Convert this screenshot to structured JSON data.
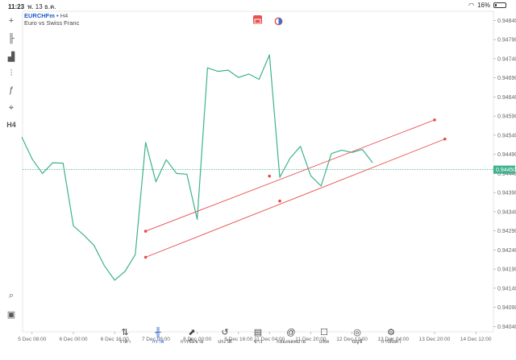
{
  "status_bar": {
    "time": "11:23",
    "date": "พ. 13 ธ.ค.",
    "battery": "16%",
    "battery_level": 0.16
  },
  "symbol": {
    "name": "EURCHFm",
    "separator": "•",
    "timeframe": "H4",
    "description": "Euro vs Swiss Franc"
  },
  "tools": [
    {
      "name": "crosshair-icon",
      "glyph": "+"
    },
    {
      "name": "candle-type-icon",
      "glyph": "╟"
    },
    {
      "name": "indicators-icon",
      "glyph": "▟"
    },
    {
      "name": "chart-settings-icon",
      "glyph": "⫶"
    },
    {
      "name": "function-icon",
      "glyph": "ƒ"
    },
    {
      "name": "objects-icon",
      "glyph": "⌖"
    },
    {
      "name": "timeframe-icon",
      "glyph": "H4"
    },
    {
      "name": "zoom-search-icon",
      "glyph": "⌕"
    },
    {
      "name": "trade-panel-icon",
      "glyph": "▣"
    }
  ],
  "chart_data": {
    "type": "line",
    "x": [
      "5 Dec 04:00",
      "5 Dec 08:00",
      "5 Dec 12:00",
      "5 Dec 16:00",
      "5 Dec 20:00",
      "6 Dec 00:00",
      "6 Dec 04:00",
      "6 Dec 08:00",
      "6 Dec 12:00",
      "6 Dec 16:00",
      "6 Dec 20:00",
      "7 Dec 00:00",
      "7 Dec 04:00",
      "7 Dec 08:00",
      "7 Dec 12:00",
      "7 Dec 16:00",
      "7 Dec 20:00",
      "8 Dec 00:00",
      "8 Dec 04:00",
      "8 Dec 08:00",
      "8 Dec 12:00",
      "8 Dec 16:00",
      "8 Dec 20:00",
      "11 Dec 00:00",
      "11 Dec 04:00",
      "11 Dec 08:00",
      "11 Dec 12:00",
      "11 Dec 16:00",
      "11 Dec 20:00",
      "12 Dec 00:00",
      "12 Dec 04:00",
      "12 Dec 08:00",
      "12 Dec 12:00",
      "12 Dec 16:00",
      "12 Dec 20:00"
    ],
    "values": [
      0.94535,
      0.94478,
      0.9444,
      0.94468,
      0.94467,
      0.94303,
      0.94279,
      0.94252,
      0.94199,
      0.94161,
      0.94184,
      0.94228,
      0.94521,
      0.94418,
      0.94476,
      0.9444,
      0.94438,
      0.9432,
      0.94716,
      0.94707,
      0.9471,
      0.94691,
      0.947,
      0.94686,
      0.9475,
      0.9443,
      0.9448,
      0.94511,
      0.94434,
      0.94407,
      0.94492,
      0.94501,
      0.94495,
      0.94503,
      0.94468
    ],
    "current_price": "0.94450",
    "current_value": 0.9445,
    "y_ticks": [
      "0.94840",
      "0.94790",
      "0.94740",
      "0.94690",
      "0.94640",
      "0.94590",
      "0.94540",
      "0.94490",
      "0.94440",
      "0.94390",
      "0.94340",
      "0.94290",
      "0.94240",
      "0.94190",
      "0.94140",
      "0.94090",
      "0.94040"
    ],
    "x_ticks": [
      "5 Dec 08:00",
      "6 Dec 00:00",
      "6 Dec 16:00",
      "7 Dec 08:00",
      "8 Dec 00:00",
      "8 Dec 16:00",
      "11 Dec 04:00",
      "11 Dec 20:00",
      "12 Dec 12:00",
      "13 Dec 04:00",
      "13 Dec 20:00",
      "14 Dec 12:00"
    ],
    "channel": [
      {
        "from": "7 Dec 04:00",
        "from_value": 0.94289,
        "mid": "11 Dec 04:00",
        "mid_value": 0.94433,
        "to": "13 Dec 20:00",
        "to_value": 0.9458
      },
      {
        "from": "7 Dec 04:00",
        "from_value": 0.94221,
        "mid": "11 Dec 08:00",
        "mid_value": 0.94368,
        "to": "14 Dec 00:00",
        "to_value": 0.9453
      }
    ],
    "ylim": [
      0.94026,
      0.94864
    ],
    "colors": {
      "line": "#3db28d",
      "channel": "#e84a4a",
      "price_label": "#3db28d"
    }
  },
  "nav": [
    {
      "name": "nav-quotes",
      "icon": "⇅",
      "label": "ราคา"
    },
    {
      "name": "nav-chart",
      "icon": "╫",
      "label": "กราฟ",
      "active": true
    },
    {
      "name": "nav-trade",
      "icon": "⬈",
      "label": "การซื้อขาย"
    },
    {
      "name": "nav-history",
      "icon": "↺",
      "label": "ประวัติ"
    },
    {
      "name": "nav-news",
      "icon": "▤",
      "label": "ข่าว"
    },
    {
      "name": "nav-mailbox",
      "icon": "@",
      "label": "กล่องจดหมาย"
    },
    {
      "name": "nav-chat",
      "icon": "☐",
      "label": "แชท"
    },
    {
      "name": "nav-accounts",
      "icon": "◎",
      "label": "บัญชี"
    },
    {
      "name": "nav-settings",
      "icon": "⚙",
      "label": "การตั้งค่า"
    }
  ]
}
